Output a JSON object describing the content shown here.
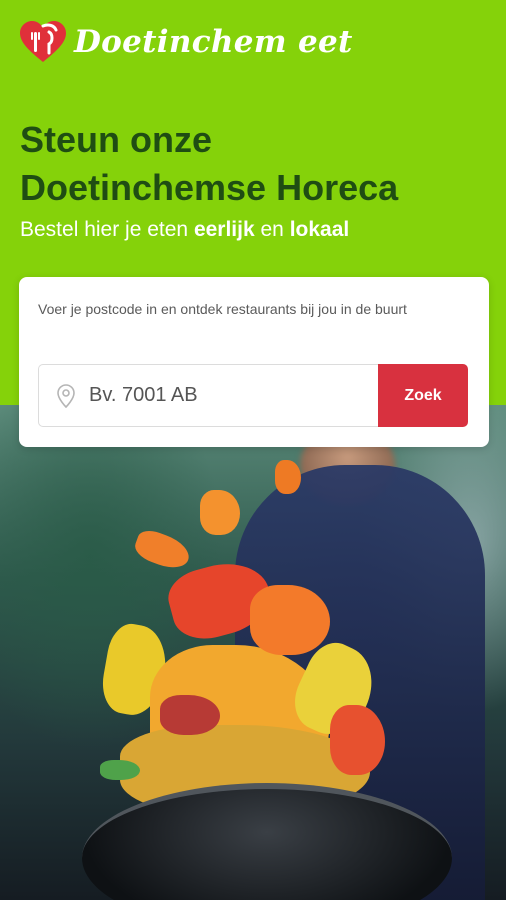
{
  "brand": {
    "name": "Doetinchem eet",
    "logo_icon": "heart-fork-knife-icon",
    "colors": {
      "header_green": "#85d20a",
      "headline_green": "#1f4d13",
      "logo_red": "#e0303a"
    }
  },
  "hero": {
    "headline_line1": "Steun onze",
    "headline_line2": "Doetinchemse Horeca",
    "sub_prefix": "Bestel hier je eten ",
    "sub_bold1": "eerlijk",
    "sub_middle": " en ",
    "sub_bold2": "lokaal"
  },
  "search": {
    "intro": "Voer je postcode in en ontdek restaurants bij jou in de buurt",
    "placeholder": "Bv. 7001 AB",
    "icon": "location-pin-icon",
    "button_label": "Zoek",
    "button_color": "#d8313f"
  },
  "background": {
    "image": "chef tossing vegetables in a wok"
  }
}
